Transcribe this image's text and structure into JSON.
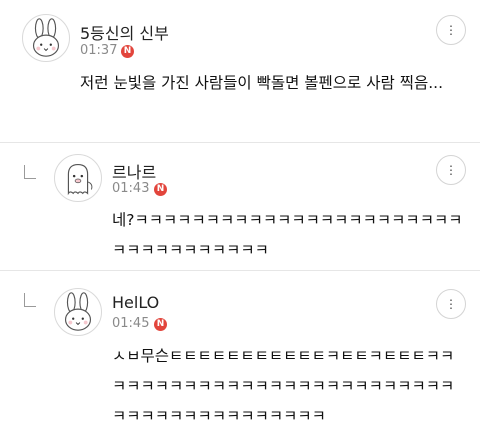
{
  "comments": [
    {
      "author": "5등신의 신부",
      "time": "01:37",
      "badge": "N",
      "text": "저런 눈빛을 가진 사람들이 빡돌면 볼펜으로 사람 찍음...",
      "more_label": "⋮"
    },
    {
      "author": "르나르",
      "time": "01:43",
      "badge": "N",
      "text": "네?ㅋㅋㅋㅋㅋㅋㅋㅋㅋㅋㅋㅋㅋㅋㅋㅋㅋㅋㅋㅋㅋㅋㅋㅋㅋㅋㅋㅋㅋㅋㅋㅋㅋㅋ",
      "more_label": "⋮"
    },
    {
      "author": "HelLO",
      "time": "01:45",
      "badge": "N",
      "text": "ㅅㅂ무슨ㅌㅌㅌㅌㅌㅌㅌㅌㅌㅌㅌㅋㅌㅌㅋㅌㅌㅌㅋㅋㅋㅋㅋㅋㅋㅋㅋㅋㅋㅋㅋㅋㅋㅋㅋㅋㅋㅋㅋㅋㅋㅋㅋㅋㅋㅋㅋㅋㅋㅋㅋㅋㅋㅋㅋㅋㅋㅋㅋ",
      "more_label": "⋮"
    }
  ],
  "icons": {
    "avatar_1": "bunny-avatar-icon",
    "avatar_2": "ghost-avatar-icon",
    "avatar_3": "bunny-avatar-icon",
    "reply": "reply-arrow-icon",
    "more": "more-options-icon"
  },
  "colors": {
    "badge": "#e2453c",
    "meta": "#8a8a8a",
    "divider": "#e6e6e6"
  }
}
